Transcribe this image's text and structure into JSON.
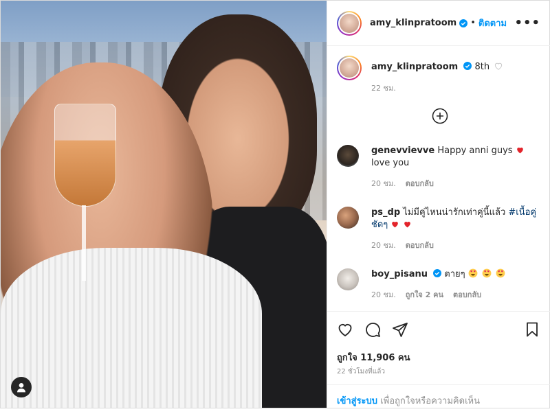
{
  "header": {
    "username": "amy_klinpratoom",
    "follow_label": "ติดตาม",
    "more_label": "•••"
  },
  "caption": {
    "username": "amy_klinpratoom",
    "text": "8th",
    "time": "22 ชม."
  },
  "comments": [
    {
      "username": "genevvievve",
      "text_before": "Happy anni guys",
      "text_after": "love you",
      "time": "20 ชม.",
      "reply_label": "ตอบกลับ"
    },
    {
      "username": "ps_dp",
      "text_before": "ไม่มีคู่ไหนน่ารักเท่าคู่นี้แล้ว",
      "hashtag": "#เนื้อคู่ชัดๆ",
      "time": "20 ชม.",
      "reply_label": "ตอบกลับ"
    },
    {
      "username": "boy_pisanu",
      "text_before": "ตายๆ",
      "time": "20 ชม.",
      "likes_label": "ถูกใจ 2 คน",
      "reply_label": "ตอบกลับ"
    }
  ],
  "post": {
    "likes": "ถูกใจ 11,906 คน",
    "ago": "22 ชั่วโมงที่แล้ว"
  },
  "login": {
    "link": "เข้าสู่ระบบ",
    "rest": " เพื่อถูกใจหรือความคิดเห็น"
  },
  "colors": {
    "link_blue": "#0095f6",
    "hashtag": "#00376b",
    "heart_red": "#ed4956",
    "muted": "#8e8e8e"
  }
}
